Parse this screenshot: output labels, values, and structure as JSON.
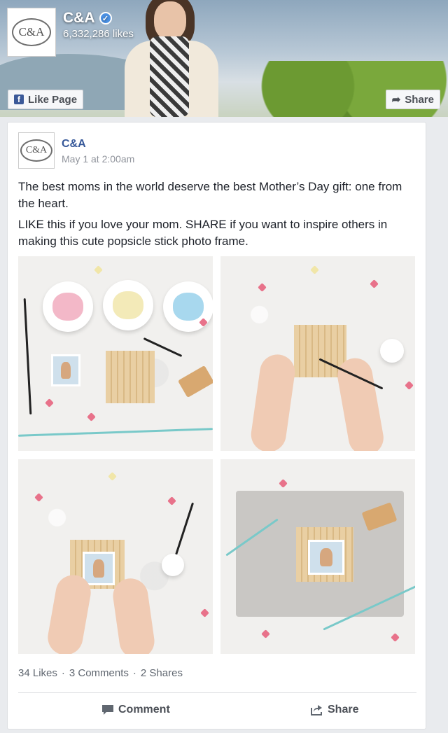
{
  "header": {
    "page_name": "C&A",
    "likes": "6,332,286 likes",
    "like_page_label": "Like Page",
    "share_label": "Share",
    "logo_text": "C&A"
  },
  "post": {
    "author": "C&A",
    "timestamp": "May 1 at 2:00am",
    "text_1": "The best moms in the world deserve the best Mother’s Day gift: one from the heart.",
    "text_2": "LIKE this if you love your mom. SHARE if you want to inspire others in making this cute popsicle stick photo frame.",
    "stats": {
      "likes": "34 Likes",
      "comments": "3 Comments",
      "shares": "2 Shares",
      "separator": "·"
    },
    "actions": {
      "comment": "Comment",
      "share": "Share"
    }
  },
  "colors": {
    "link": "#365899",
    "facebook_blue": "#3b5998",
    "verified": "#4a90e2"
  }
}
